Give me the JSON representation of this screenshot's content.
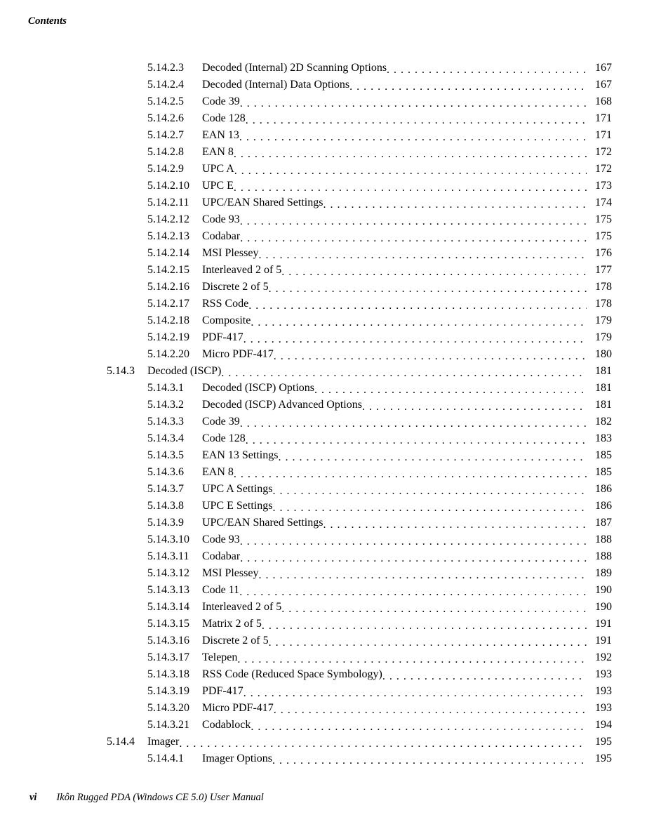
{
  "running_head": "Contents",
  "footer_page": "vi",
  "footer_text": "Ikôn Rugged PDA (Windows CE 5.0) User Manual",
  "rows": [
    {
      "sec": "",
      "num": "5.14.2.3",
      "title": "Decoded (Internal) 2D Scanning Options",
      "page": "167"
    },
    {
      "sec": "",
      "num": "5.14.2.4",
      "title": "Decoded (Internal) Data Options",
      "page": "167"
    },
    {
      "sec": "",
      "num": "5.14.2.5",
      "title": "Code 39",
      "page": "168"
    },
    {
      "sec": "",
      "num": "5.14.2.6",
      "title": "Code 128",
      "page": "171"
    },
    {
      "sec": "",
      "num": "5.14.2.7",
      "title": "EAN 13",
      "page": "171"
    },
    {
      "sec": "",
      "num": "5.14.2.8",
      "title": "EAN 8",
      "page": "172"
    },
    {
      "sec": "",
      "num": "5.14.2.9",
      "title": "UPC A",
      "page": "172"
    },
    {
      "sec": "",
      "num": "5.14.2.10",
      "title": "UPC E",
      "page": "173"
    },
    {
      "sec": "",
      "num": "5.14.2.11",
      "title": "UPC/EAN Shared Settings",
      "page": "174"
    },
    {
      "sec": "",
      "num": "5.14.2.12",
      "title": "Code 93",
      "page": "175"
    },
    {
      "sec": "",
      "num": "5.14.2.13",
      "title": "Codabar",
      "page": "175"
    },
    {
      "sec": "",
      "num": "5.14.2.14",
      "title": "MSI Plessey",
      "page": "176"
    },
    {
      "sec": "",
      "num": "5.14.2.15",
      "title": "Interleaved 2 of 5",
      "page": "177"
    },
    {
      "sec": "",
      "num": "5.14.2.16",
      "title": "Discrete 2 of 5",
      "page": "178"
    },
    {
      "sec": "",
      "num": "5.14.2.17",
      "title": "RSS Code",
      "page": "178"
    },
    {
      "sec": "",
      "num": "5.14.2.18",
      "title": "Composite",
      "page": "179"
    },
    {
      "sec": "",
      "num": "5.14.2.19",
      "title": "PDF-417",
      "page": "179"
    },
    {
      "sec": "",
      "num": "5.14.2.20",
      "title": "Micro PDF-417",
      "page": "180"
    },
    {
      "sec": "5.14.3",
      "num": "",
      "title": "Decoded (ISCP)",
      "page": "181"
    },
    {
      "sec": "",
      "num": "5.14.3.1",
      "title": "Decoded (ISCP) Options",
      "page": "181"
    },
    {
      "sec": "",
      "num": "5.14.3.2",
      "title": "Decoded (ISCP) Advanced Options",
      "page": "181"
    },
    {
      "sec": "",
      "num": "5.14.3.3",
      "title": "Code 39",
      "page": "182"
    },
    {
      "sec": "",
      "num": "5.14.3.4",
      "title": "Code 128",
      "page": "183"
    },
    {
      "sec": "",
      "num": "5.14.3.5",
      "title": "EAN 13 Settings",
      "page": "185"
    },
    {
      "sec": "",
      "num": "5.14.3.6",
      "title": "EAN 8",
      "page": "185"
    },
    {
      "sec": "",
      "num": "5.14.3.7",
      "title": "UPC A Settings",
      "page": "186"
    },
    {
      "sec": "",
      "num": "5.14.3.8",
      "title": "UPC E Settings",
      "page": "186"
    },
    {
      "sec": "",
      "num": "5.14.3.9",
      "title": "UPC/EAN Shared Settings",
      "page": "187"
    },
    {
      "sec": "",
      "num": "5.14.3.10",
      "title": "Code 93",
      "page": "188"
    },
    {
      "sec": "",
      "num": "5.14.3.11",
      "title": "Codabar",
      "page": "188"
    },
    {
      "sec": "",
      "num": "5.14.3.12",
      "title": "MSI Plessey",
      "page": "189"
    },
    {
      "sec": "",
      "num": "5.14.3.13",
      "title": "Code 11",
      "page": "190"
    },
    {
      "sec": "",
      "num": "5.14.3.14",
      "title": "Interleaved 2 of 5",
      "page": "190"
    },
    {
      "sec": "",
      "num": "5.14.3.15",
      "title": "Matrix 2 of 5",
      "page": "191"
    },
    {
      "sec": "",
      "num": "5.14.3.16",
      "title": "Discrete 2 of 5",
      "page": "191"
    },
    {
      "sec": "",
      "num": "5.14.3.17",
      "title": "Telepen",
      "page": "192"
    },
    {
      "sec": "",
      "num": "5.14.3.18",
      "title": "RSS Code (Reduced Space Symbology)",
      "page": "193"
    },
    {
      "sec": "",
      "num": "5.14.3.19",
      "title": "PDF-417",
      "page": "193"
    },
    {
      "sec": "",
      "num": "5.14.3.20",
      "title": "Micro PDF-417",
      "page": "193"
    },
    {
      "sec": "",
      "num": "5.14.3.21",
      "title": "Codablock",
      "page": "194"
    },
    {
      "sec": "5.14.4",
      "num": "",
      "title": "Imager",
      "page": "195"
    },
    {
      "sec": "",
      "num": "5.14.4.1",
      "title": "Imager Options",
      "page": "195"
    }
  ]
}
